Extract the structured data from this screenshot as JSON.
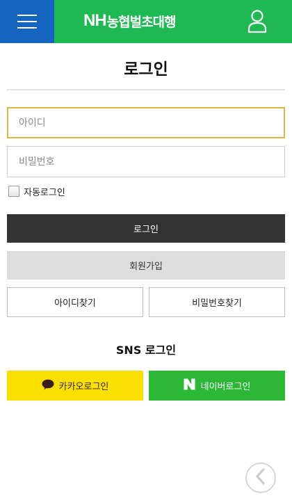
{
  "header": {
    "brand_prefix": "NH",
    "brand_name": "농협벌초대행",
    "colors": {
      "bar": "#1fb954",
      "menu": "#1565c0"
    }
  },
  "login": {
    "title": "로그인",
    "id_placeholder": "아이디",
    "pw_placeholder": "비밀번호",
    "auto_login_label": "자동로그인",
    "login_button": "로그인",
    "join_button": "회원가입",
    "find_id_button": "아이디찾기",
    "find_pw_button": "비밀번호찾기"
  },
  "sns": {
    "title": "SNS 로그인",
    "kakao_label": "카카오로그인",
    "naver_label": "네이버로그인",
    "colors": {
      "kakao": "#f9e000",
      "naver": "#2db736"
    }
  }
}
